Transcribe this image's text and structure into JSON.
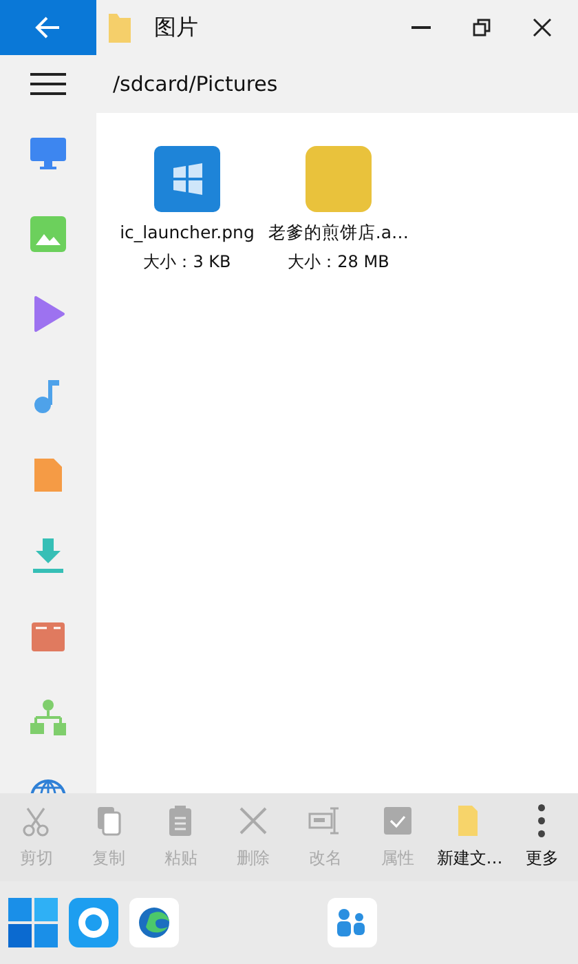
{
  "window": {
    "title": "图片"
  },
  "path": "/sdcard/Pictures",
  "sidebar": {
    "items": [
      {
        "kind": "desktop"
      },
      {
        "kind": "image"
      },
      {
        "kind": "video"
      },
      {
        "kind": "music"
      },
      {
        "kind": "document"
      },
      {
        "kind": "download"
      },
      {
        "kind": "app"
      },
      {
        "kind": "network"
      },
      {
        "kind": "web"
      }
    ]
  },
  "files": [
    {
      "name": "ic_launcher.png",
      "size": "大小：3 KB",
      "kind": "tile"
    },
    {
      "name": "老爹的煎饼店.a…",
      "size": "大小：28 MB",
      "kind": "photo"
    }
  ],
  "toolbar": [
    {
      "label": "剪切",
      "kind": "cut",
      "disabled": true
    },
    {
      "label": "复制",
      "kind": "copy",
      "disabled": true
    },
    {
      "label": "粘贴",
      "kind": "paste",
      "disabled": true
    },
    {
      "label": "删除",
      "kind": "delete",
      "disabled": true
    },
    {
      "label": "改名",
      "kind": "rename",
      "disabled": true
    },
    {
      "label": "属性",
      "kind": "properties",
      "disabled": true
    },
    {
      "label": "新建文…",
      "kind": "folder",
      "disabled": false
    },
    {
      "label": "更多",
      "kind": "more",
      "disabled": false
    }
  ],
  "taskbar": [
    {
      "kind": "start"
    },
    {
      "kind": "circle"
    },
    {
      "kind": "browser"
    },
    {
      "kind": "people"
    }
  ]
}
